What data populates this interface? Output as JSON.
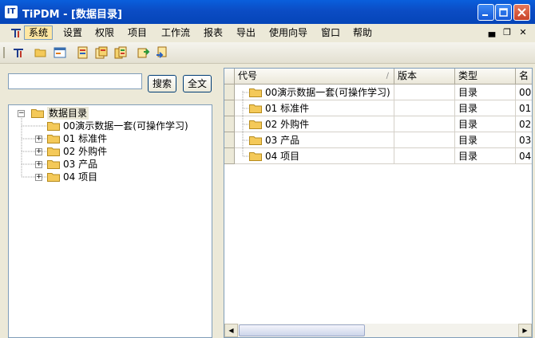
{
  "window": {
    "title": "TiPDM - [数据目录]",
    "icon_label": "IT"
  },
  "menu": {
    "items": [
      "系统",
      "设置",
      "权限",
      "项目",
      "工作流",
      "报表",
      "导出",
      "使用向导",
      "窗口",
      "帮助"
    ],
    "active_index": 0
  },
  "search": {
    "value": "",
    "search_label": "搜索",
    "fulltext_label": "全文"
  },
  "tree": {
    "root": "数据目录",
    "children": [
      "00演示数据一套(可操作学习)",
      "01 标准件",
      "02 外购件",
      "03 产品",
      "04 项目"
    ]
  },
  "grid": {
    "columns": [
      "代号",
      "版本",
      "类型",
      "名"
    ],
    "rows": [
      {
        "code": "00演示数据一套(可操作学习)",
        "version": "",
        "type": "目录",
        "name": "00"
      },
      {
        "code": "01 标准件",
        "version": "",
        "type": "目录",
        "name": "01"
      },
      {
        "code": "02 外购件",
        "version": "",
        "type": "目录",
        "name": "02"
      },
      {
        "code": "03 产品",
        "version": "",
        "type": "目录",
        "name": "03"
      },
      {
        "code": "04 项目",
        "version": "",
        "type": "目录",
        "name": "04"
      }
    ]
  },
  "colors": {
    "titlebar": "#0a5fdc",
    "menu_active_bg": "#ffe7a2",
    "folder": "#f4c959"
  }
}
